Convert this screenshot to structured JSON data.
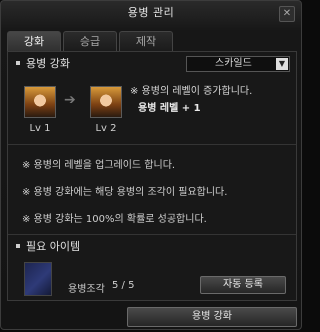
{
  "window": {
    "title": "용병 관리"
  },
  "tabs": [
    {
      "label": "강화",
      "active": true
    },
    {
      "label": "승급",
      "active": false
    },
    {
      "label": "제작",
      "active": false
    }
  ],
  "enhance": {
    "section_title": "용병 강화",
    "dropdown_value": "스카일드",
    "from_level": "Lv 1",
    "to_level": "Lv 2",
    "effect_line1": "※ 용병의 레벨이 증가합니다.",
    "effect_line2": "용병 레벨 + 1"
  },
  "notes": [
    "※ 용병의 레벨을 업그레이드 합니다.",
    "※ 용병 강화에는 해당 용병의 조각이 필요합니다.",
    "※ 용병 강화는 100%의 확률로 성공합니다."
  ],
  "required": {
    "section_title": "필요 아이템",
    "item_name": "용병조각",
    "item_count": "5 / 5",
    "auto_register_label": "자동 등록"
  },
  "footer": {
    "enhance_button_label": "용병 강화"
  },
  "icons": {
    "close": "close-icon",
    "dropdown": "chevron-down-icon",
    "arrow": "arrow-right-icon"
  },
  "colors": {
    "background": "#141414",
    "panel": "#181818",
    "button": "#3a3a3a"
  }
}
